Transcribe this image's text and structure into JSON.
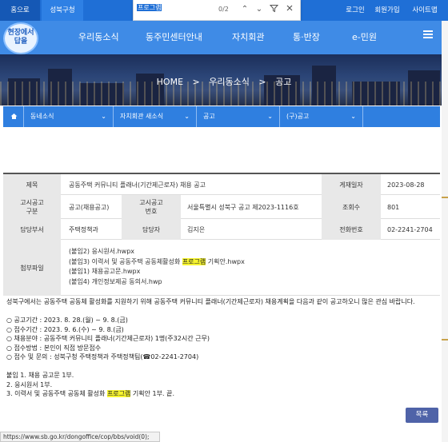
{
  "topbar": {
    "home": "홈으로",
    "district": "성북구청",
    "login": "로그인",
    "join": "회원가입",
    "sitemap": "사이트맵"
  },
  "findbar": {
    "query": "프로그램",
    "count": "0/2"
  },
  "logo": {
    "line1": "현장에서",
    "line2": "답을"
  },
  "nav": [
    "우리동소식",
    "동주민센터안내",
    "자치회관",
    "통·반장",
    "e-민원"
  ],
  "breadcrumb": {
    "home": "HOME",
    "sep": ">",
    "section": "우리동소식",
    "page": "공고"
  },
  "subnav": [
    "동네소식",
    "자치회관 새소식",
    "공고",
    "(구)공고"
  ],
  "post": {
    "labels": {
      "title": "제목",
      "date": "게재일자",
      "type": "고시공고\n구분",
      "number": "고시공고\n번호",
      "views": "조회수",
      "dept": "담당부서",
      "person": "담당자",
      "phone": "전화번호",
      "attachments": "첨부파일"
    },
    "title": "공동주택 커뮤니티 플래너(기간제근로자) 채용 공고",
    "date": "2023-08-28",
    "type": "공고(채용공고)",
    "number": "서울특별시 성북구 공고 제2023-1116호",
    "views": "801",
    "dept": "주택정책과",
    "person": "김지은",
    "phone": "02-2241-2704",
    "attachments": [
      {
        "pre": "(붙임2) 응시원서.hwpx",
        "mark": "",
        "post": ""
      },
      {
        "pre": "(붙임3) 이력서 및 공동주택 공동체활성화 ",
        "mark": "프로그램",
        "post": " 기획안.hwpx"
      },
      {
        "pre": "(붙임1) 채용공고문.hwpx",
        "mark": "",
        "post": ""
      },
      {
        "pre": "(붙임4) 개인정보제공 동의서.hwp",
        "mark": "",
        "post": ""
      }
    ]
  },
  "body": {
    "intro": "성북구에서는 공동주택 공동체 활성화를 지원하기 위해 공동주택 커뮤니티 플래너(기간제근로자) 채용계획을 다음과 같이 공고하오니 많은 관심 바랍니다.",
    "items": [
      "○ 공고기간 : 2023. 8. 28.(월) ~ 9. 8.(금)",
      "○ 접수기간 : 2023. 9. 6.(수) ~ 9. 8.(금)",
      "○ 채용분야 : 공동주택 커뮤니티 플래너(기간제근로자) 1명(주32시간 근무)",
      "○ 접수방법 : 본인이 직접 방문접수",
      "○ 접수 및 문의 : 성북구청 주택정책과 주택정책팀(☎02-2241-2704)"
    ],
    "enc1": "붙임 1. 채용 공고문 1부.",
    "enc2": "2. 응시원서 1부.",
    "enc3_pre": "3. 이력서 및 공동주택 공동체 활성화 ",
    "enc3_mark": "프로그램",
    "enc3_post": " 기획안 1부. 끝."
  },
  "list_button": "목록",
  "status_url": "https://www.sb.go.kr/dongoffice/cop/bbs/void(0);",
  "colors": {
    "primary": "#1f6fd6",
    "nav": "#3f8be6",
    "highlight": "#f6f430",
    "button": "#4f63a8"
  }
}
